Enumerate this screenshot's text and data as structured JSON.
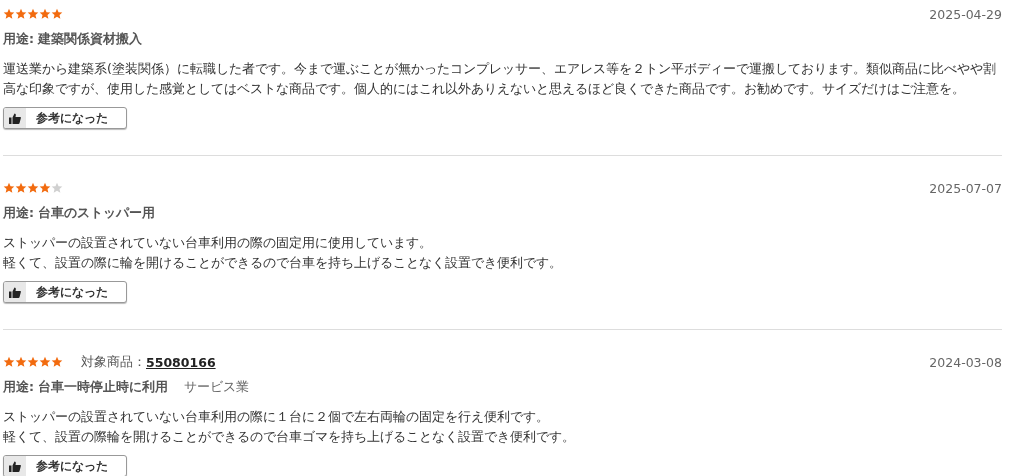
{
  "reviews": [
    {
      "stars": 5,
      "date": "2025-04-29",
      "usage": "用途: 建築関係資材搬入",
      "body_lines": [
        "運送業から建築系(塗装関係）に転職した者です。今まで運ぶことが無かったコンプレッサー、エアレス等を２トン平ボディーで運搬しております。類似商品に比べやや割",
        "高な印象ですが、使用した感覚としてはベストな商品です。個人的にはこれ以外ありえないと思えるほど良くできた商品です。お勧めです。サイズだけはご注意を。"
      ],
      "helpful_button": "参考になった"
    },
    {
      "stars": 4,
      "date": "2025-07-07",
      "usage": "用途: 台車のストッパー用",
      "body_lines": [
        "ストッパーの設置されていない台車利用の際の固定用に使用しています。",
        "軽くて、設置の際に輪を開けることができるので台車を持ち上げることなく設置でき便利です。"
      ],
      "helpful_button": "参考になった"
    },
    {
      "stars": 5,
      "product_label": "対象商品：",
      "product_link": "55080166",
      "date": "2024-03-08",
      "usage": "用途: 台車一時停止時に利用",
      "industry": "サービス業",
      "body_lines": [
        "ストッパーの設置されていない台車利用の際に１台に２個で左右両輪の固定を行え便利です。",
        "軽くて、設置の際輪を開けることができるので台車ゴマを持ち上げることなく設置でき便利です。"
      ],
      "helpful_button": "参考になった"
    }
  ]
}
